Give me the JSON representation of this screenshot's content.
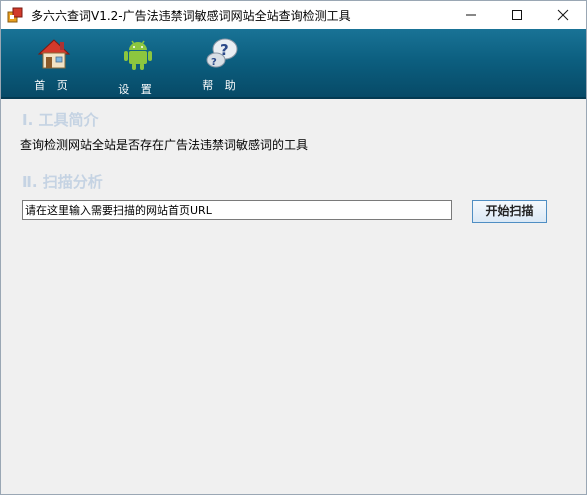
{
  "window": {
    "title": "多六六查词V1.2-广告法违禁词敏感词网站全站查询检测工具",
    "controls": {
      "minimize": "—",
      "maximize": "☐",
      "close": "✕"
    }
  },
  "toolbar": {
    "home_label": "首 页",
    "settings_label": "设 置",
    "help_label": "帮 助"
  },
  "sections": {
    "intro_heading": "Ⅰ. 工具简介",
    "intro_text": "查询检测网站全站是否存在广告法违禁词敏感词的工具",
    "scan_heading": "Ⅱ. 扫描分析"
  },
  "scan": {
    "url_value": "请在这里输入需要扫描的网站首页URL",
    "start_label": "开始扫描"
  },
  "colors": {
    "toolbar": "#0c5f80",
    "heading": "#c5d3e3"
  }
}
